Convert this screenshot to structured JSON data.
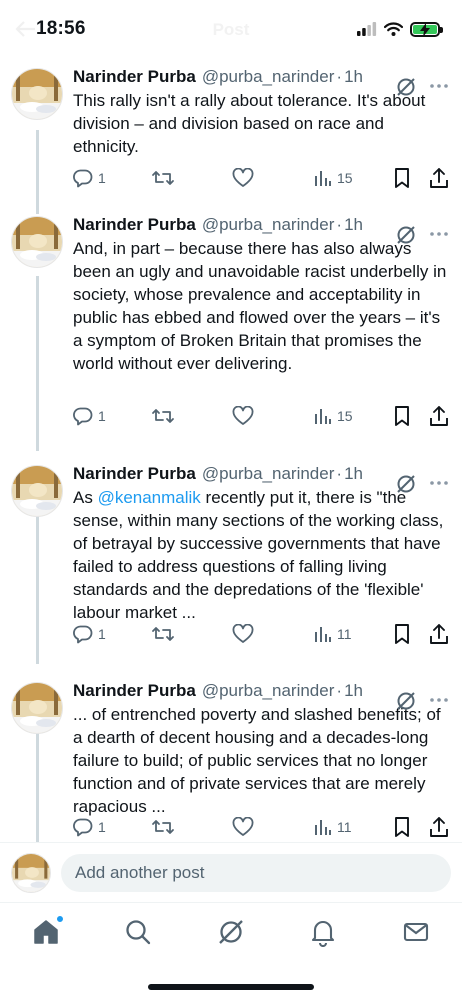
{
  "status_bar": {
    "time": "18:56",
    "title": "Post"
  },
  "tweets": [
    {
      "author": "Narinder Purba",
      "handle": "@purba_narinder",
      "separator": "·",
      "age": "1h",
      "text": "This rally isn't a rally about tolerance. It's about division – and division based on race and ethnicity.",
      "replies": "1",
      "views": "15"
    },
    {
      "author": "Narinder Purba",
      "handle": "@purba_narinder",
      "separator": "·",
      "age": "1h",
      "text": "And, in part – because there has also always been an ugly and unavoidable racist underbelly in society, whose prevalence and acceptability in public has ebbed and flowed over the years – it's a symptom of Broken Britain that promises the world without ever delivering.",
      "replies": "1",
      "views": "15"
    },
    {
      "author": "Narinder Purba",
      "handle": "@purba_narinder",
      "separator": "·",
      "age": "1h",
      "text_prefix": "As ",
      "mention": "@kenanmalik",
      "text": " recently put it, there is \"the sense, within many sections of the working class, of betrayal by successive governments that have failed to address questions of falling living standards and the depredations of the 'flexible' labour market ...",
      "replies": "1",
      "views": "11"
    },
    {
      "author": "Narinder Purba",
      "handle": "@purba_narinder",
      "separator": "·",
      "age": "1h",
      "text": "... of entrenched poverty and slashed benefits; of a dearth of decent housing and a decades-long failure to build; of public services that no longer function and of private services that are merely rapacious ...",
      "replies": "1",
      "views": "11"
    }
  ],
  "composer": {
    "placeholder": "Add another post"
  },
  "tabbar": {
    "items": [
      "home-icon",
      "search-icon",
      "grok-icon",
      "notifications-icon",
      "messages-icon"
    ],
    "active": "home",
    "has_unread_dot": true
  },
  "colors": {
    "accent": "#1d9bf0",
    "muted": "#536471",
    "text": "#0f1419",
    "battery": "#34c759"
  }
}
